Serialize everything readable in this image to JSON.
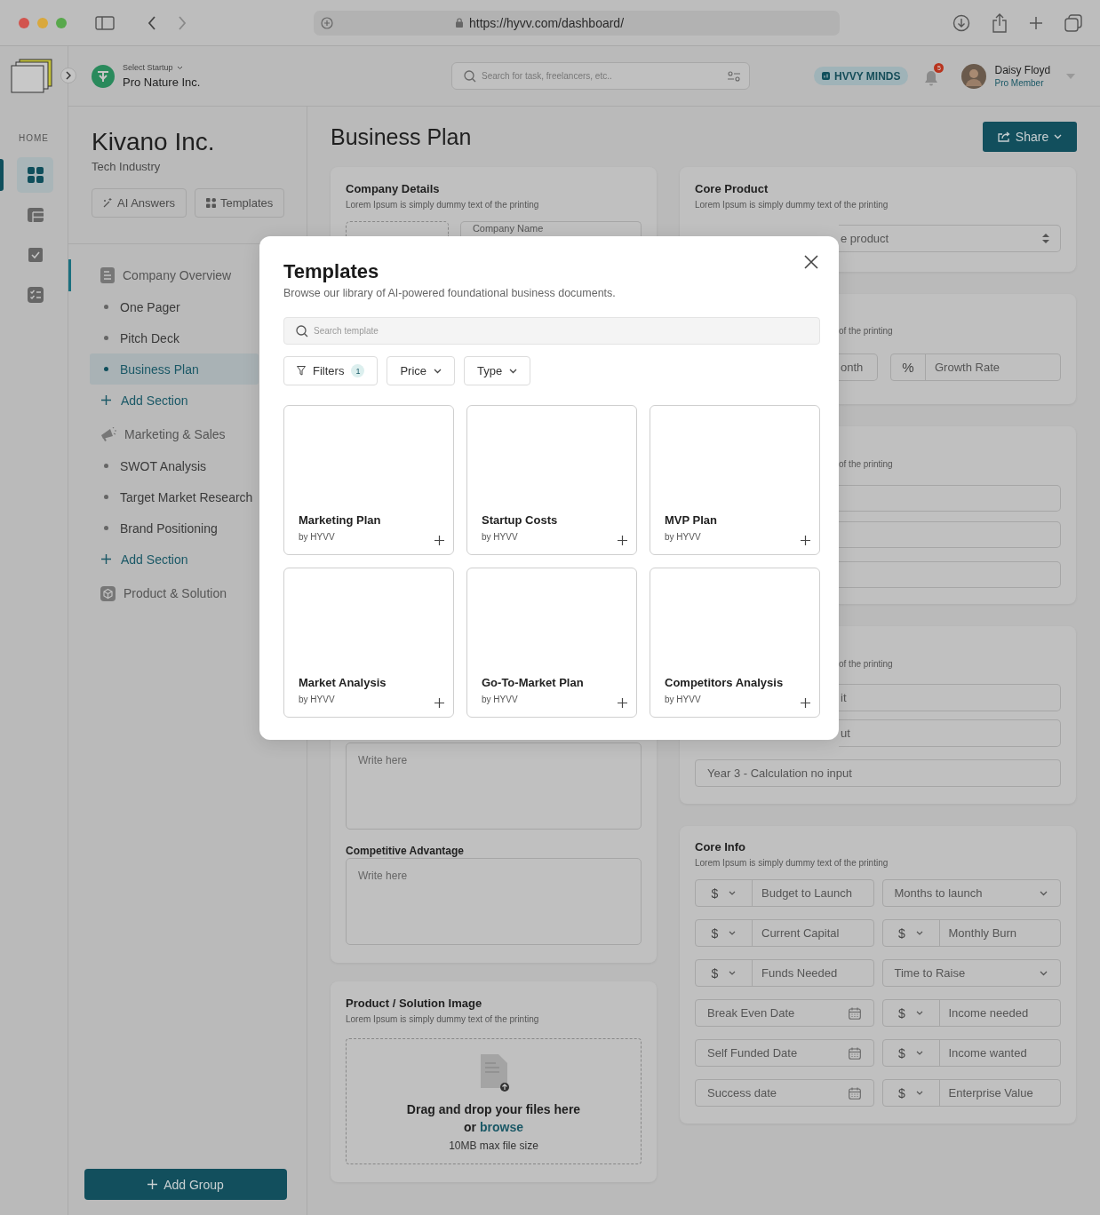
{
  "browser": {
    "url": "https://hyvv.com/dashboard/"
  },
  "header": {
    "startup_label": "Select Startup",
    "startup_name": "Pro Nature Inc.",
    "search": {
      "placeholder": "Search for task, freelancers, etc.."
    },
    "brand_badge": "HVVY MINDS",
    "notifications": "5",
    "user": {
      "name": "Daisy Floyd",
      "role": "Pro Member"
    }
  },
  "rail": {
    "label": "HOME",
    "items": [
      {
        "kind": "grid",
        "selected": true
      },
      {
        "kind": "table",
        "selected": false
      },
      {
        "kind": "check",
        "selected": false
      },
      {
        "kind": "checklist",
        "selected": false
      }
    ]
  },
  "company": {
    "name": "Kivano Inc.",
    "industry": "Tech Industry",
    "actions": [
      {
        "label": "AI Answers",
        "kind": "ai"
      },
      {
        "label": "Templates",
        "kind": "templates"
      }
    ]
  },
  "nav": {
    "groups": [
      {
        "label": "Company Overview",
        "kind": "document",
        "active": true,
        "items": [
          {
            "label": "One Pager",
            "kind": "page",
            "selected": false
          },
          {
            "label": "Pitch Deck",
            "kind": "page",
            "selected": false
          },
          {
            "label": "Business Plan",
            "kind": "page",
            "selected": true
          },
          {
            "label": "Add Section",
            "kind": "add",
            "selected": false
          }
        ]
      },
      {
        "label": "Marketing & Sales",
        "kind": "megaphone",
        "active": false,
        "items": [
          {
            "label": "SWOT Analysis",
            "kind": "page",
            "selected": false
          },
          {
            "label": "Target Market Research",
            "kind": "page",
            "selected": false
          },
          {
            "label": "Brand Positioning",
            "kind": "page",
            "selected": false
          },
          {
            "label": "Add Section",
            "kind": "add",
            "selected": false
          }
        ]
      },
      {
        "label": "Product & Solution",
        "kind": "cube",
        "active": false
      }
    ]
  },
  "add_group": "Add Group",
  "page": {
    "title": "Business Plan",
    "share": "Share"
  },
  "company_details": {
    "title": "Company Details",
    "description": "Lorem Ipsum is simply dummy text of the printing",
    "name_field": "Company Name",
    "textarea": {
      "placeholder": "Write here"
    },
    "competitive_advantage": {
      "label": "Competitive Advantage",
      "placeholder": "Write here"
    }
  },
  "upload": {
    "title": "Product / Solution Image",
    "description": "Lorem Ipsum is simply dummy text of the printing",
    "drop_text": "Drag and drop your files here",
    "or": "or",
    "browse": "browse",
    "limit": "10MB max file size"
  },
  "core_product": {
    "title": "Core Product",
    "description": "Lorem Ipsum is simply dummy text of the printing",
    "price_field": "e product"
  },
  "revenue_card": {
    "description": "of the printing",
    "month_field": "onth",
    "growth_field": {
      "prefix": "%",
      "placeholder": "Growth Rate"
    }
  },
  "details_card": {
    "description": "of the printing"
  },
  "projection_card": {
    "description": "of the printing",
    "fields": [
      {
        "kind": "partial",
        "placeholder": "it"
      },
      {
        "kind": "partial",
        "placeholder": "ut"
      },
      {
        "kind": "full",
        "placeholder": "Year 3 - Calculation no input"
      }
    ]
  },
  "core_info": {
    "title": "Core Info",
    "description": "Lorem Ipsum is simply dummy text of the printing",
    "fields": [
      {
        "kind": "currency",
        "prefix": "$",
        "placeholder": "Budget to Launch"
      },
      {
        "kind": "select",
        "placeholder": "Months to launch"
      },
      {
        "kind": "currency",
        "prefix": "$",
        "placeholder": "Current Capital"
      },
      {
        "kind": "currency",
        "prefix": "$",
        "placeholder": "Monthly Burn"
      },
      {
        "kind": "currency",
        "prefix": "$",
        "placeholder": "Funds Needed"
      },
      {
        "kind": "select",
        "placeholder": "Time to Raise"
      },
      {
        "kind": "date",
        "placeholder": "Break Even Date"
      },
      {
        "kind": "currency",
        "prefix": "$",
        "placeholder": "Income needed"
      },
      {
        "kind": "date",
        "placeholder": "Self Funded Date"
      },
      {
        "kind": "currency",
        "prefix": "$",
        "placeholder": "Income wanted"
      },
      {
        "kind": "date",
        "placeholder": "Success date"
      },
      {
        "kind": "currency",
        "prefix": "$",
        "placeholder": "Enterprise Value"
      }
    ]
  },
  "modal": {
    "title": "Templates",
    "subtitle": "Browse our library of AI-powered foundational business documents.",
    "search": {
      "placeholder": "Search template"
    },
    "filters": [
      {
        "label": "Filters",
        "kind": "filter",
        "count": "1"
      },
      {
        "label": "Price",
        "kind": "dropdown"
      },
      {
        "label": "Type",
        "kind": "dropdown"
      }
    ],
    "templates": [
      {
        "name": "Marketing Plan",
        "author": "by HYVV"
      },
      {
        "name": "Startup Costs",
        "author": "by HYVV"
      },
      {
        "name": "MVP Plan",
        "author": "by HYVV"
      },
      {
        "name": "Market Analysis",
        "author": "by HYVV"
      },
      {
        "name": "Go-To-Market Plan",
        "author": "by HYVV"
      },
      {
        "name": "Competitors Analysis",
        "author": "by HYVV"
      }
    ]
  }
}
